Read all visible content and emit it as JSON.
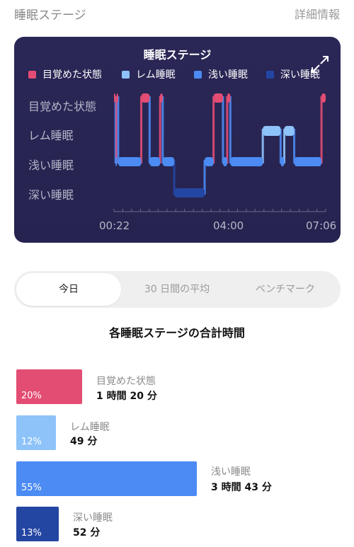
{
  "header": {
    "title": "睡眠ステージ",
    "detail_link": "詳細情報"
  },
  "card": {
    "title": "睡眠ステージ",
    "legend": [
      {
        "label": "目覚めた状態",
        "color": "#e34d73"
      },
      {
        "label": "レム睡眠",
        "color": "#8ec3fa"
      },
      {
        "label": "浅い睡眠",
        "color": "#4b8bf3"
      },
      {
        "label": "深い睡眠",
        "color": "#2446a3"
      }
    ],
    "stage_labels": [
      "目覚めた状態",
      "レム睡眠",
      "浅い睡眠",
      "深い睡眠"
    ],
    "time_ticks": [
      "00:22",
      "04:00",
      "07:06"
    ],
    "icon": "expand-icon"
  },
  "chart_data": {
    "type": "area",
    "title": "睡眠ステージ",
    "x_start": "00:22",
    "x_end": "07:06",
    "x_ticks": [
      "00:22",
      "04:00",
      "07:06"
    ],
    "stages": [
      "目覚めた状態",
      "レム睡眠",
      "浅い睡眠",
      "深い睡眠"
    ],
    "segments": [
      {
        "stage": "目覚めた状態",
        "start": "00:22",
        "end": "00:25"
      },
      {
        "stage": "浅い睡眠",
        "start": "00:25",
        "end": "00:27"
      },
      {
        "stage": "目覚めた状態",
        "start": "00:27",
        "end": "00:30"
      },
      {
        "stage": "浅い睡眠",
        "start": "00:30",
        "end": "01:14"
      },
      {
        "stage": "目覚めた状態",
        "start": "01:14",
        "end": "01:30"
      },
      {
        "stage": "浅い睡眠",
        "start": "01:30",
        "end": "01:50"
      },
      {
        "stage": "目覚めた状態",
        "start": "01:50",
        "end": "01:55"
      },
      {
        "stage": "浅い睡眠",
        "start": "01:55",
        "end": "02:17"
      },
      {
        "stage": "深い睡眠",
        "start": "02:17",
        "end": "03:15"
      },
      {
        "stage": "浅い睡眠",
        "start": "03:15",
        "end": "03:32"
      },
      {
        "stage": "目覚めた状態",
        "start": "03:32",
        "end": "03:50"
      },
      {
        "stage": "浅い睡眠",
        "start": "03:50",
        "end": "03:58"
      },
      {
        "stage": "目覚めた状態",
        "start": "03:58",
        "end": "04:04"
      },
      {
        "stage": "浅い睡眠",
        "start": "04:04",
        "end": "05:06"
      },
      {
        "stage": "レム睡眠",
        "start": "05:06",
        "end": "05:40"
      },
      {
        "stage": "浅い睡眠",
        "start": "05:40",
        "end": "05:47"
      },
      {
        "stage": "レム睡眠",
        "start": "05:47",
        "end": "06:06"
      },
      {
        "stage": "浅い睡眠",
        "start": "06:06",
        "end": "06:58"
      },
      {
        "stage": "目覚めた状態",
        "start": "06:58",
        "end": "07:06"
      }
    ],
    "colors": {
      "目覚めた状態": "#e34d73",
      "レム睡眠": "#8ec3fa",
      "浅い睡眠": "#4b8bf3",
      "深い睡眠": "#2446a3"
    }
  },
  "tabs": [
    {
      "label": "今日",
      "active": true
    },
    {
      "label": "30 日間の平均",
      "active": false
    },
    {
      "label": "ベンチマーク",
      "active": false
    }
  ],
  "summary": {
    "title": "各睡眠ステージの合計時間",
    "rows": [
      {
        "label": "目覚めた状態",
        "value": "1 時間 20 分",
        "percent_label": "20%",
        "percent": 20,
        "color": "#e34d73"
      },
      {
        "label": "レム睡眠",
        "value": "49 分",
        "percent_label": "12%",
        "percent": 12,
        "color": "#8ec3fa"
      },
      {
        "label": "浅い睡眠",
        "value": "3 時間 43 分",
        "percent_label": "55%",
        "percent": 55,
        "color": "#4b8bf3"
      },
      {
        "label": "深い睡眠",
        "value": "52 分",
        "percent_label": "13%",
        "percent": 13,
        "color": "#2446a3"
      }
    ]
  }
}
